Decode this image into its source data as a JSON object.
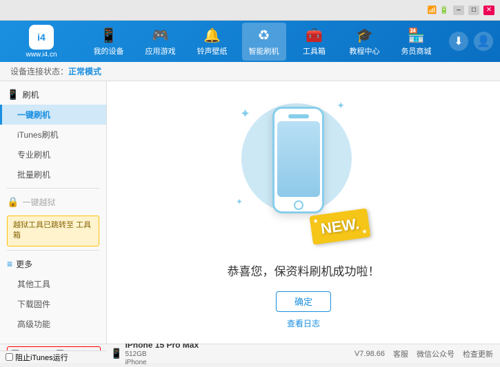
{
  "topbar": {
    "icons": [
      "signal-icon",
      "battery-icon",
      "minimize-icon",
      "maximize-icon",
      "close-icon"
    ]
  },
  "header": {
    "logo": {
      "symbol": "i4",
      "url": "www.i4.cn"
    },
    "nav": [
      {
        "id": "my-device",
        "icon": "📱",
        "label": "我的设备"
      },
      {
        "id": "apps-games",
        "icon": "🎮",
        "label": "应用游戏"
      },
      {
        "id": "ringtones",
        "icon": "🔔",
        "label": "铃声壁纸"
      },
      {
        "id": "smart-flash",
        "icon": "♻",
        "label": "智能刷机",
        "active": true
      },
      {
        "id": "toolbox",
        "icon": "🧰",
        "label": "工具箱"
      },
      {
        "id": "tutorial",
        "icon": "🎓",
        "label": "教程中心"
      },
      {
        "id": "service",
        "icon": "🏪",
        "label": "务员商城"
      }
    ],
    "right_buttons": [
      "download-icon",
      "user-icon"
    ]
  },
  "breadcrumb": {
    "prefix": "设备连接状态：",
    "status": "正常模式"
  },
  "sidebar": {
    "sections": [
      {
        "id": "flash",
        "icon": "📱",
        "label": "刷机",
        "items": [
          {
            "id": "one-key-flash",
            "label": "一键刷机",
            "active": true
          },
          {
            "id": "itunes-flash",
            "label": "iTunes刷机"
          },
          {
            "id": "pro-flash",
            "label": "专业刷机"
          },
          {
            "id": "batch-flash",
            "label": "批量刷机"
          }
        ]
      },
      {
        "id": "one-key-jb",
        "icon": "🔒",
        "label": "一键越狱",
        "disabled": true,
        "notice": "越狱工具已跳转至\n工具箱"
      },
      {
        "id": "more",
        "icon": "≡",
        "label": "更多",
        "items": [
          {
            "id": "other-tools",
            "label": "其他工具"
          },
          {
            "id": "download-fw",
            "label": "下载固件"
          },
          {
            "id": "advanced",
            "label": "高级功能"
          }
        ]
      }
    ],
    "bottom": {
      "auto_activate_label": "自动激活",
      "guide_label": "新旧向导"
    }
  },
  "content": {
    "success_message": "恭喜您，保资料刷机成功啦！",
    "confirm_button": "确定",
    "log_link": "查看日志"
  },
  "bottom_bar": {
    "auto_activate": "自动激活",
    "guide": "新旧向导",
    "stop_itunes": "阻止iTunes运行",
    "device": {
      "name": "iPhone 15 Pro Max",
      "storage": "512GB",
      "type": "iPhone"
    },
    "version": "V7.98.66",
    "links": [
      "客服",
      "微信公众号",
      "检查更新"
    ]
  }
}
